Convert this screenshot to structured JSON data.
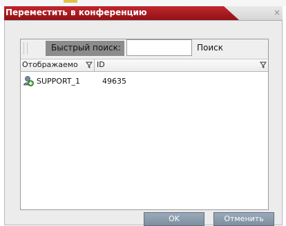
{
  "dialog": {
    "title": "Переместить в конференцию",
    "close_symbol": "×"
  },
  "search": {
    "label": "Быстрый поиск:",
    "value": "",
    "button_label": "Поиск"
  },
  "table": {
    "columns": [
      "Отображаемо",
      "ID"
    ],
    "rows": [
      {
        "name": "SUPPORT_1",
        "id": "49635",
        "icon": "add-user-icon"
      }
    ]
  },
  "footer": {
    "ok_label": "OK",
    "cancel_label": "Отменить"
  },
  "colors": {
    "title_bar": "#b01d22",
    "button": "#8a9aab"
  }
}
